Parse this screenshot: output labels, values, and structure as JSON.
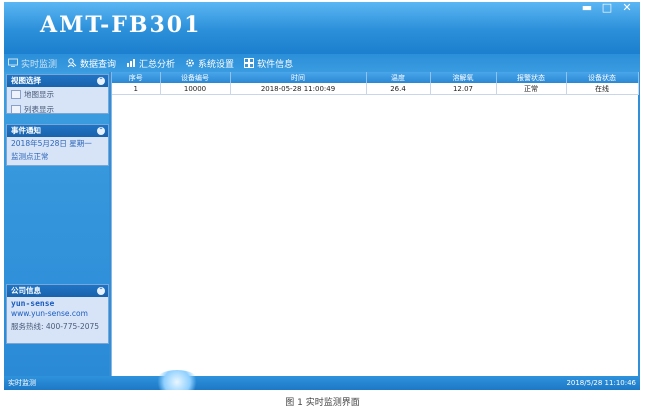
{
  "window": {
    "title": "AMT-FB301",
    "buttons": {
      "minimize": "▬",
      "maximize": "□",
      "close": "✕"
    }
  },
  "menu": {
    "items": [
      {
        "label": "实时监测",
        "icon": "monitor-icon"
      },
      {
        "label": "数据查询",
        "icon": "search-people-icon"
      },
      {
        "label": "汇总分析",
        "icon": "bar-chart-icon"
      },
      {
        "label": "系统设置",
        "icon": "gear-icon"
      },
      {
        "label": "软件信息",
        "icon": "grid-icon"
      }
    ]
  },
  "sidebar": {
    "view": {
      "title": "视图选择",
      "items": [
        "地图显示",
        "列表显示"
      ]
    },
    "events": {
      "title": "事件通知",
      "lines": [
        "2018年5月28日 星期一",
        "监测点正常"
      ]
    },
    "company": {
      "title": "公司信息",
      "name": "yun-sense",
      "url": "www.yun-sense.com",
      "hotline": "服务热线: 400-775-2075"
    }
  },
  "table": {
    "headers": [
      "序号",
      "设备编号",
      "时间",
      "温度",
      "溶解氧",
      "报警状态",
      "设备状态"
    ],
    "rows": [
      [
        "1",
        "10000",
        "2018-05-28 11:00:49",
        "26.4",
        "12.07",
        "正常",
        "在线"
      ]
    ]
  },
  "status": {
    "left": "实时监测",
    "right": "2018/5/28 11:10:46"
  },
  "caption": "图 1 实时监测界面",
  "colors": {
    "accent": "#2b8fd9",
    "ok": "#2a7f2a",
    "panel": "#d7e4f7"
  }
}
